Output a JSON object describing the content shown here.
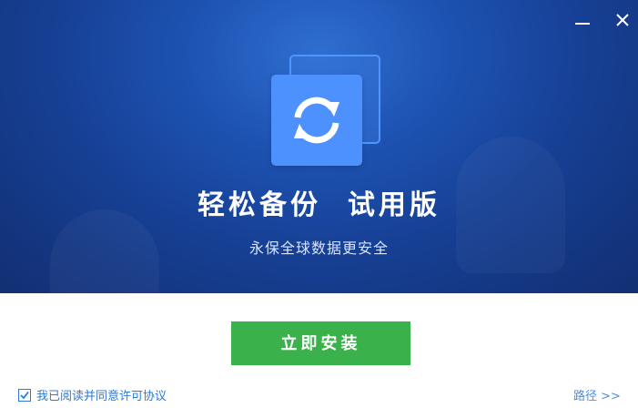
{
  "window": {
    "minimize_icon": "minimize-icon",
    "close_icon": "close-icon"
  },
  "hero": {
    "logo_icon": "sync-icon",
    "title": "轻松备份  试用版",
    "subtitle": "永保全球数据更安全"
  },
  "actions": {
    "install_label": "立即安装",
    "agreement_label": "我已阅读并同意许可协议",
    "agreement_checked": true,
    "path_label": "路径 >>"
  },
  "colors": {
    "hero_bg": "#1d52b2",
    "logo_blue": "#4d91ff",
    "install_green": "#3ab14a",
    "link_blue": "#2e7ad6"
  }
}
